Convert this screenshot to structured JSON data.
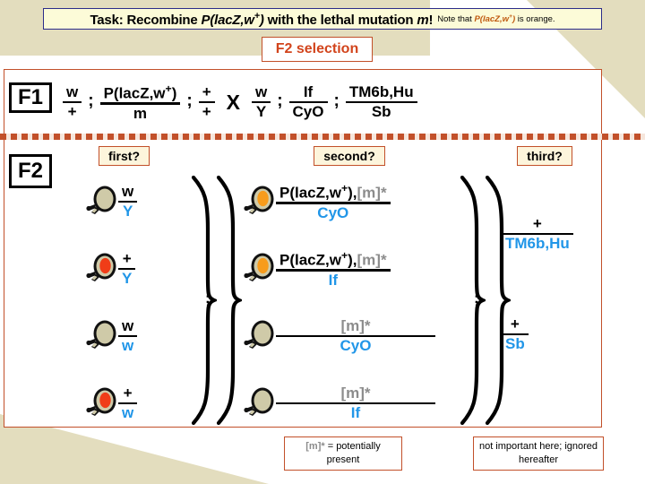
{
  "task": {
    "label": "Task:",
    "text_before": " Recombine ",
    "gene": "P(lacZ,w",
    "gene_sup": "+",
    "gene_close": ")",
    "text_mid": " with the lethal mutation ",
    "mutation": "m",
    "bang": "!",
    "note_before": "Note that ",
    "note_gene": "P(lacZ,w",
    "note_gene_sup": "+",
    "note_gene_close": ")",
    "note_after": " is orange."
  },
  "title": "F2 selection",
  "stages": {
    "f1_label": "F1",
    "f2_label": "F2"
  },
  "f1_cross": {
    "semicolon": ";",
    "cross_symbol": "X",
    "female": [
      {
        "num": "w",
        "den": "+"
      },
      {
        "num": "P(lacZ,w+)",
        "num_base": "P(lacZ,w",
        "num_sup": "+",
        "num_tail": ")",
        "den": "m"
      },
      {
        "num": "+",
        "den": "+"
      }
    ],
    "male": [
      {
        "num": "w",
        "den": "Y"
      },
      {
        "num": "If",
        "den": "CyO"
      },
      {
        "num": "TM6b,Hu",
        "den": "Sb"
      }
    ]
  },
  "chips": {
    "first": "first?",
    "second": "second?",
    "third": "third?"
  },
  "f2": {
    "column1": [
      {
        "eye": "white",
        "num": "w",
        "den": "Y"
      },
      {
        "eye": "red",
        "num": "+",
        "den": "Y"
      },
      {
        "eye": "white",
        "num": "w",
        "den": "w"
      },
      {
        "eye": "red",
        "num": "+",
        "den": "w"
      }
    ],
    "column2": [
      {
        "eye": "orange",
        "num_base": "P(lacZ,w",
        "num_sup": "+",
        "num_tail": "),",
        "num_grey": "[m]*",
        "den": "CyO"
      },
      {
        "eye": "orange",
        "num_base": "P(lacZ,w",
        "num_sup": "+",
        "num_tail": "),",
        "num_grey": "[m]*",
        "den": "If"
      },
      {
        "eye": "white",
        "num_base": "",
        "num_sup": "",
        "num_tail": "",
        "num_grey": "[m]*",
        "den": "CyO"
      },
      {
        "eye": "white",
        "num_base": "",
        "num_sup": "",
        "num_tail": "",
        "num_grey": "[m]*",
        "den": "If"
      }
    ],
    "column3": [
      {
        "num": "+",
        "den": "TM6b,Hu"
      },
      {
        "num": "+",
        "den": "Sb"
      }
    ],
    "brace_semicolon": ";"
  },
  "notes": {
    "left_marker": "[m]*",
    "left_text": " = potentially present",
    "right_text": "not important here; ignored hereafter"
  },
  "colors": {
    "accent_border": "#c2502a",
    "title_text": "#d2441c",
    "banner_bg": "#fcfbd8",
    "banner_border": "#2c2c8a",
    "blue_allele": "#2196e8",
    "grey_allele": "#8c8c8c",
    "eye_white": "#cfcaa8",
    "eye_red": "#f03d18",
    "eye_orange": "#f89c1c",
    "wedge": "#e3ddbe"
  }
}
